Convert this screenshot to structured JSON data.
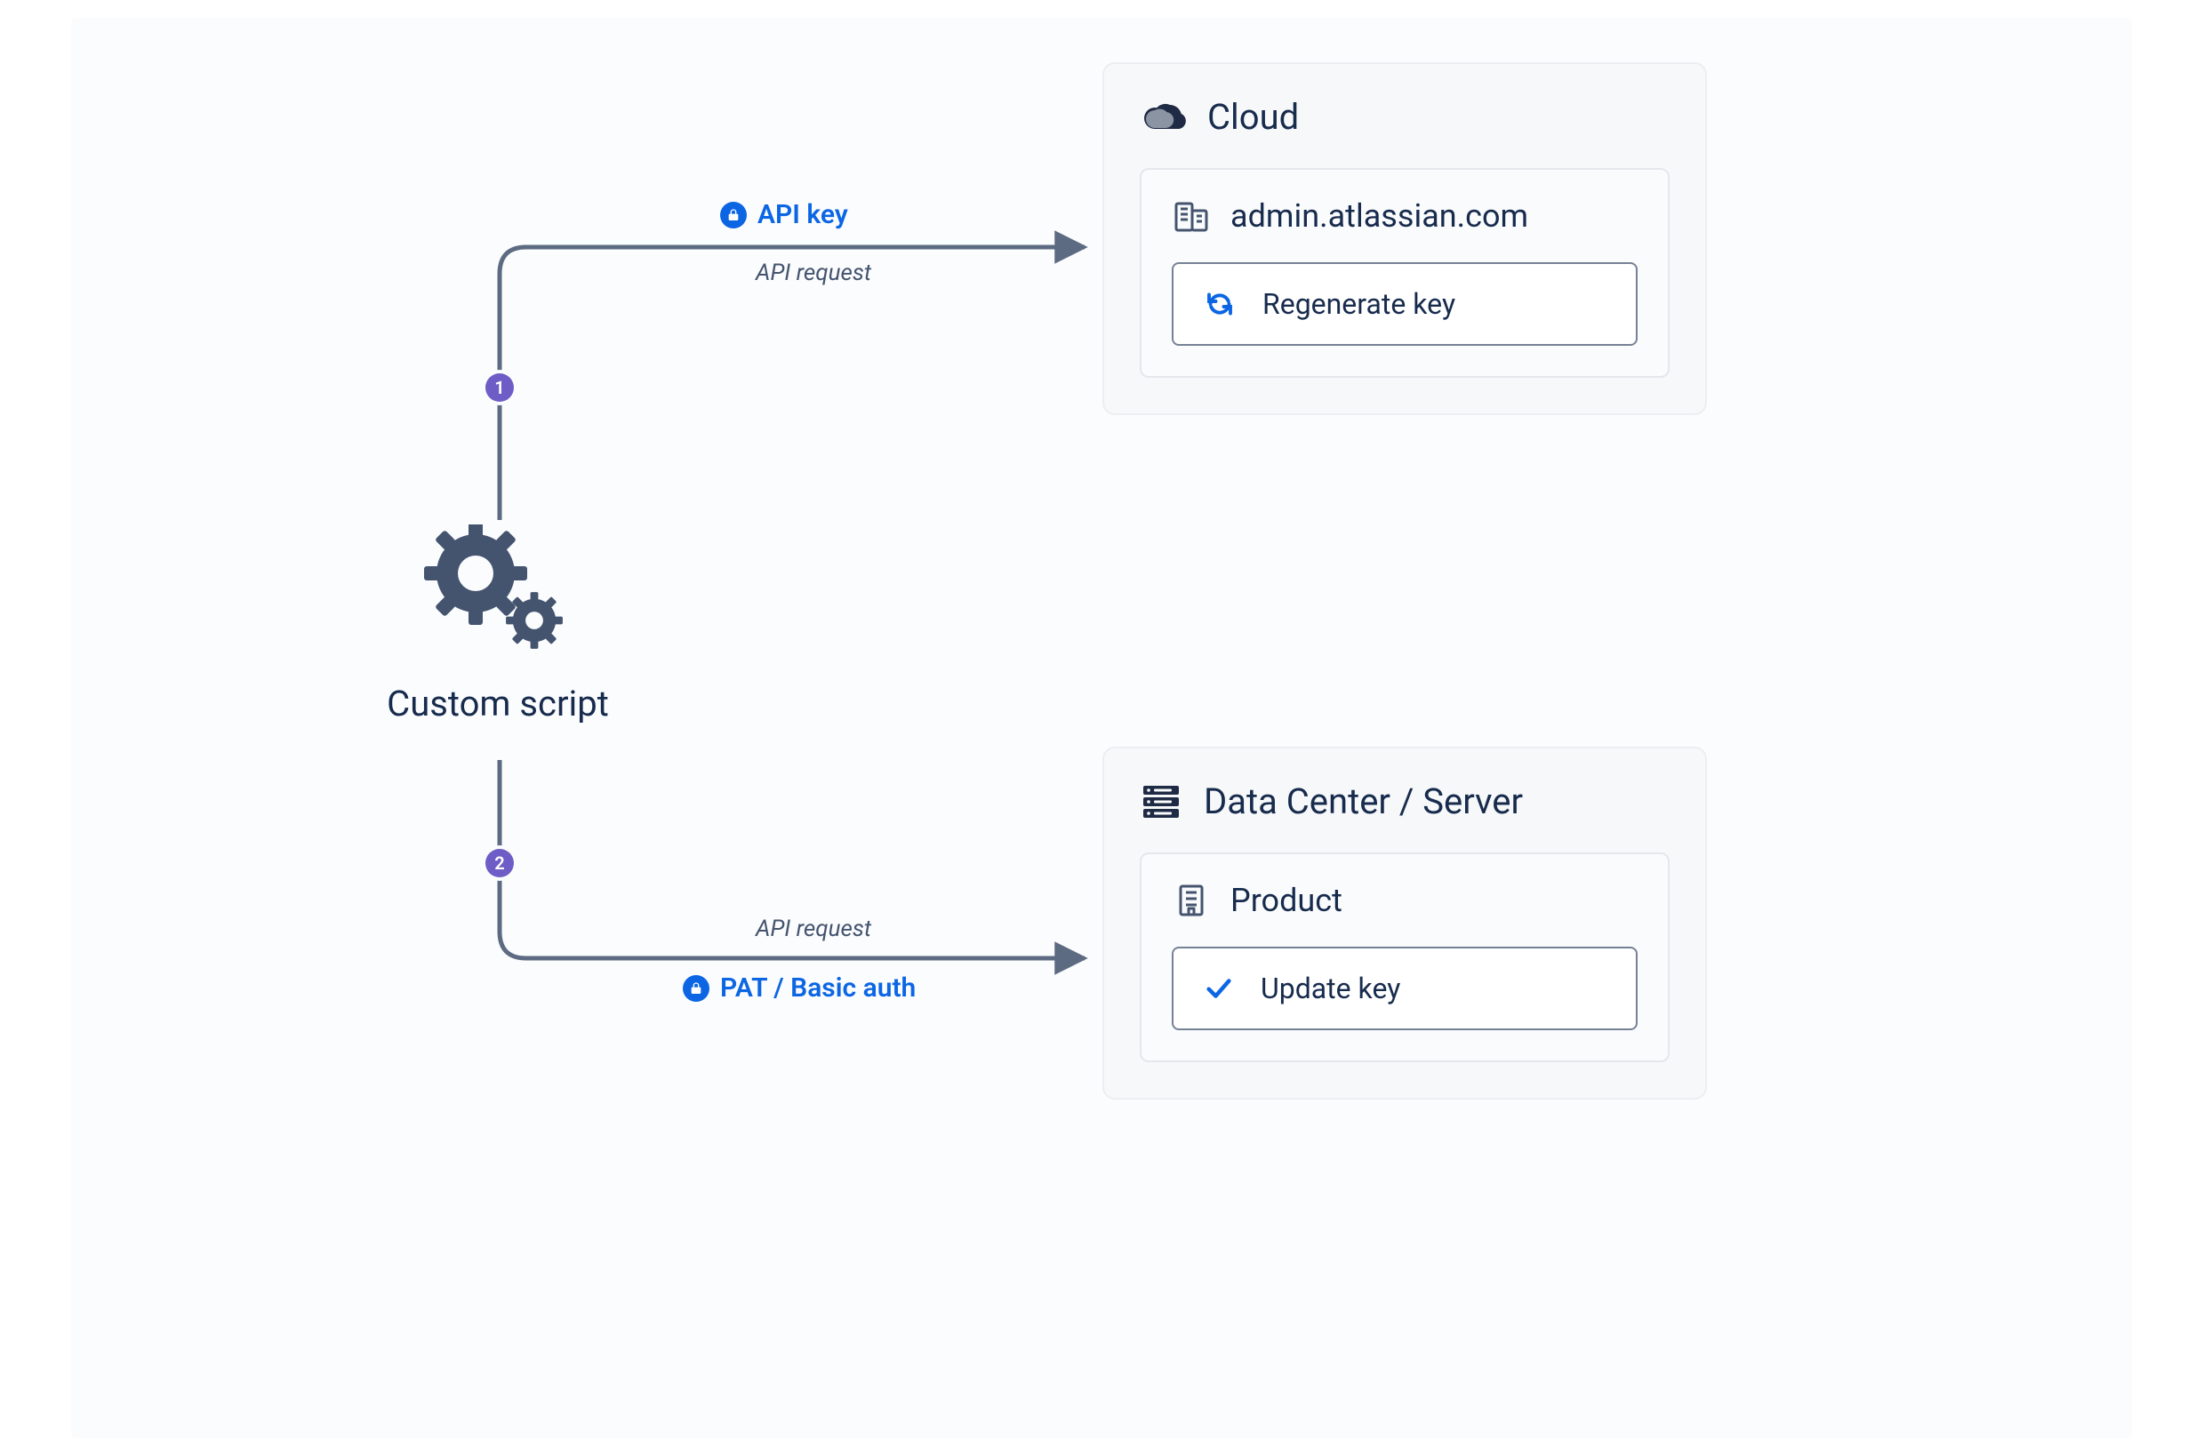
{
  "script_node": {
    "label": "Custom script"
  },
  "edges": {
    "top": {
      "step": "1",
      "auth_label": "API key",
      "sublabel": "API request"
    },
    "bottom": {
      "step": "2",
      "auth_label": "PAT / Basic auth",
      "sublabel": "API request"
    }
  },
  "panels": {
    "cloud": {
      "title": "Cloud",
      "sub_title": "admin.atlassian.com",
      "action": "Regenerate key"
    },
    "dc": {
      "title": "Data Center / Server",
      "sub_title": "Product",
      "action": "Update key"
    }
  },
  "icons": {
    "gears": "gear-cluster-icon",
    "cloud": "cloud-icon",
    "server": "server-stack-icon",
    "building_pair": "buildings-icon",
    "building_single": "building-icon",
    "refresh": "refresh-icon",
    "check": "check-icon",
    "lock": "lock-icon"
  }
}
